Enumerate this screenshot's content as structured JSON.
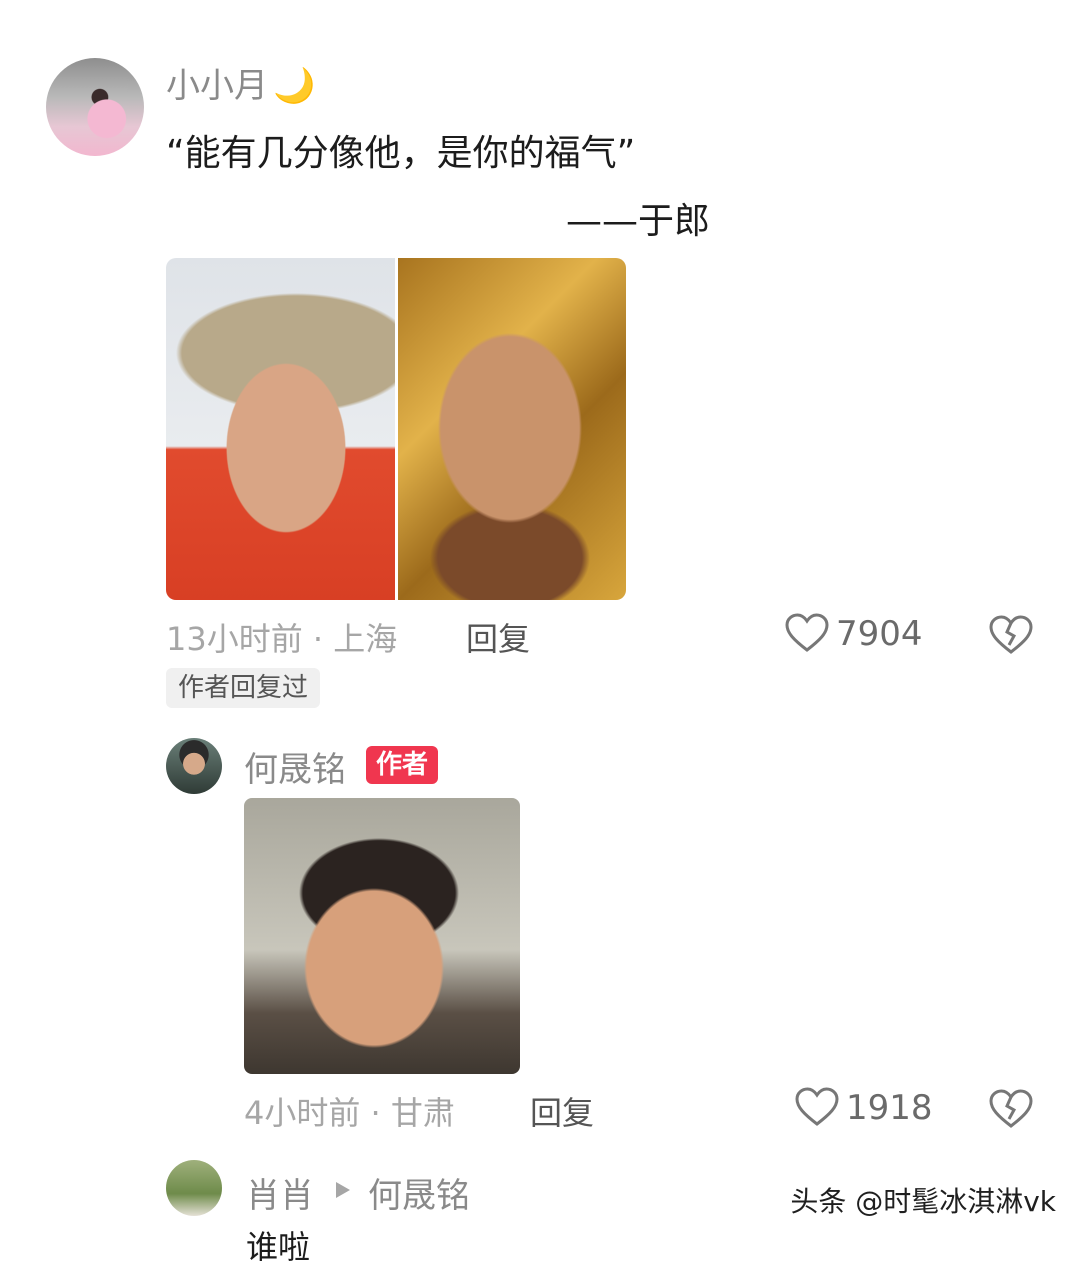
{
  "comment1": {
    "username": "小小月",
    "quote": "“能有几分像他，是你的福气”",
    "signature": "——于郎",
    "meta": "13小时前 · 上海",
    "reply_label": "回复",
    "likes": "7904",
    "author_replied_badge": "作者回复过"
  },
  "reply1": {
    "username": "何晟铭",
    "author_badge": "作者",
    "meta": "4小时前 · 甘肃",
    "reply_label": "回复",
    "likes": "1918"
  },
  "reply2": {
    "username": "肖肖",
    "reply_to": "何晟铭",
    "partial_text": "谁啦"
  },
  "watermark": "头条 @时髦冰淇淋vk",
  "colors": {
    "author_badge_bg": "#f0364f",
    "meta_gray": "#a6a6a6"
  },
  "icons": [
    "heart-outline-icon",
    "broken-heart-icon",
    "moon-icon",
    "play-triangle-icon"
  ]
}
